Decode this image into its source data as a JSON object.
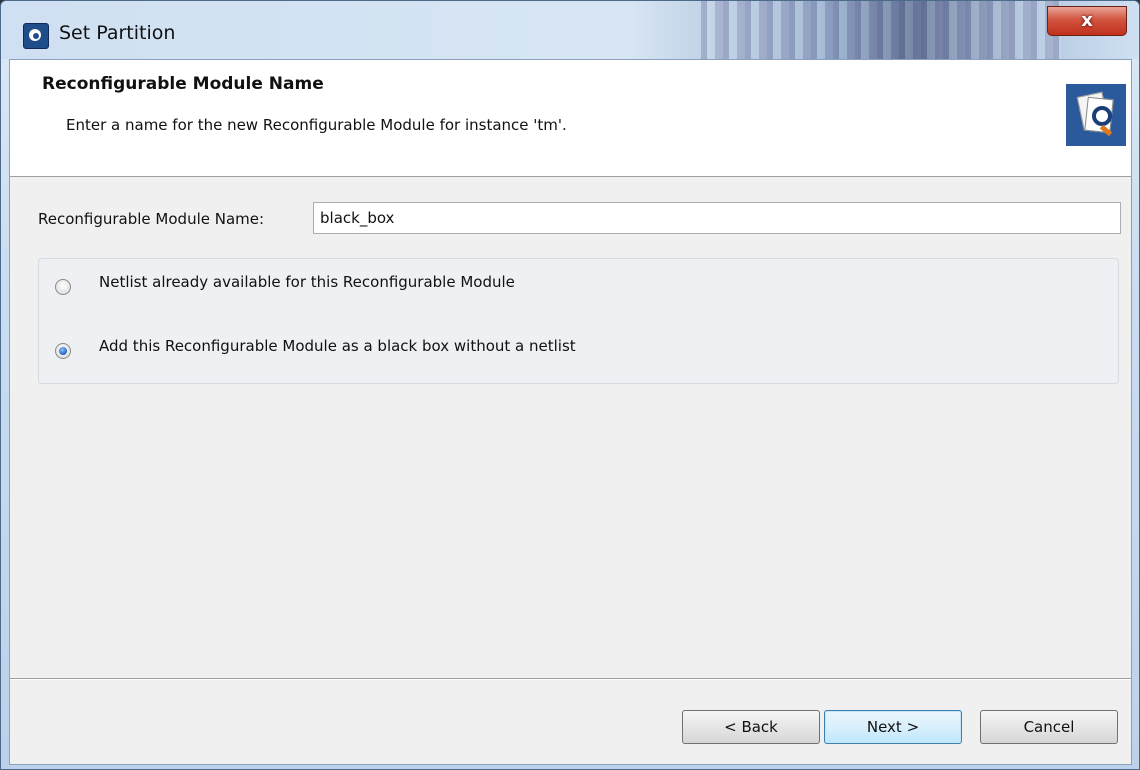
{
  "window": {
    "title": "Set Partition",
    "close_label": "x"
  },
  "header": {
    "title": "Reconfigurable Module Name",
    "description": "Enter a name for the new Reconfigurable Module for instance 'tm'."
  },
  "form": {
    "name_label": "Reconfigurable Module Name:",
    "name_value": "black_box"
  },
  "options": [
    {
      "label": "Netlist already available for this Reconfigurable Module",
      "selected": false
    },
    {
      "label": "Add this Reconfigurable Module as a black box without a netlist",
      "selected": true
    }
  ],
  "buttons": {
    "back": "< Back",
    "next": "Next >",
    "cancel": "Cancel"
  },
  "colors": {
    "header_icon_bg": "#2a5a9c",
    "close_button": "#c0301c",
    "primary_button_border": "#3c7fb1"
  }
}
